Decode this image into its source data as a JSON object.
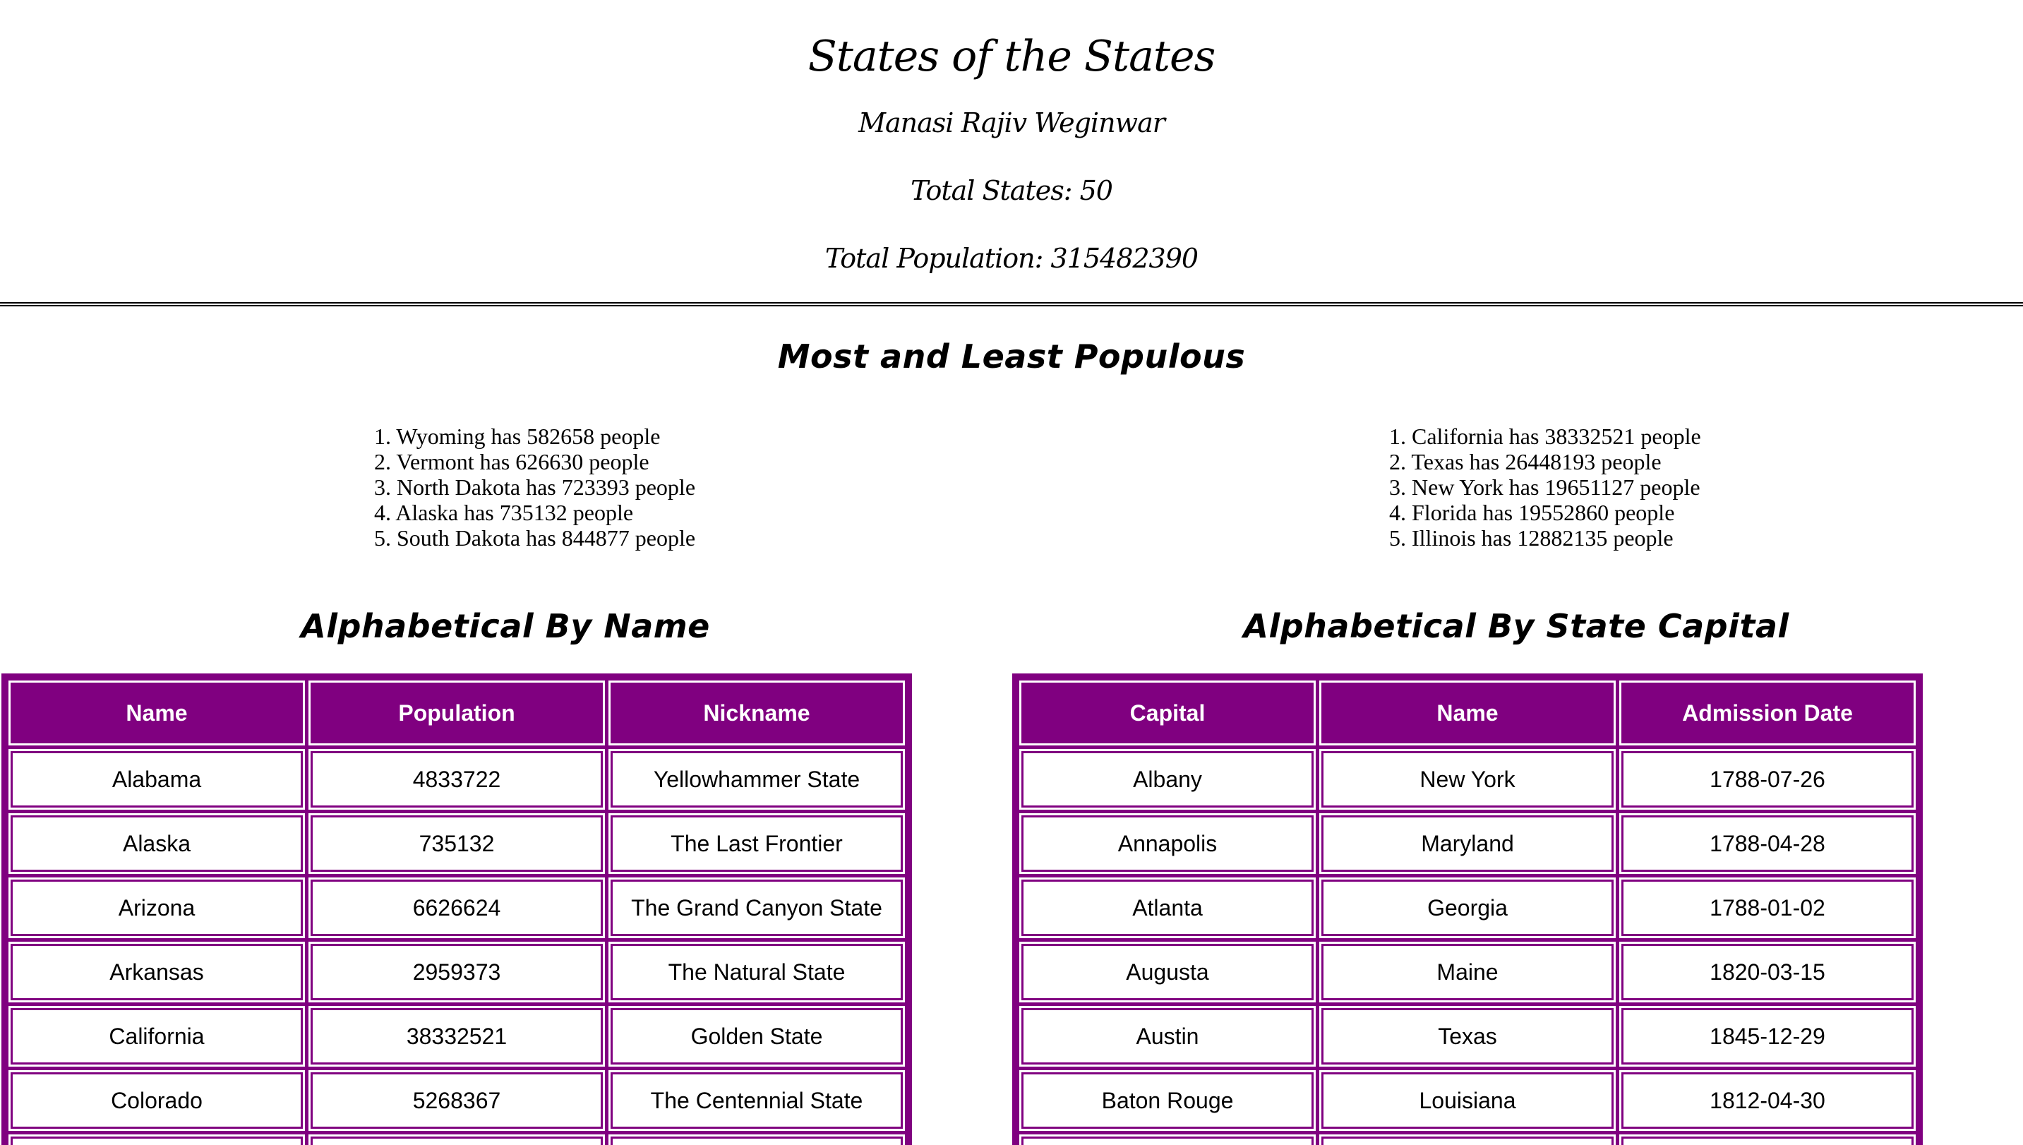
{
  "header": {
    "title": "States of the States",
    "author": "Manasi Rajiv Weginwar",
    "total_states": "Total States: 50",
    "total_population": "Total Population: 315482390"
  },
  "populous": {
    "title": "Most and Least Populous",
    "least": [
      "Wyoming has 582658 people",
      "Vermont has 626630 people",
      "North Dakota has 723393 people",
      "Alaska has 735132 people",
      "South Dakota has 844877 people"
    ],
    "most": [
      "California has 38332521 people",
      "Texas has 26448193 people",
      "New York has 19651127 people",
      "Florida has 19552860 people",
      "Illinois has 12882135 people"
    ]
  },
  "by_name": {
    "title": "Alphabetical By Name",
    "columns": [
      "Name",
      "Population",
      "Nickname"
    ],
    "rows": [
      [
        "Alabama",
        "4833722",
        "Yellowhammer State"
      ],
      [
        "Alaska",
        "735132",
        "The Last Frontier"
      ],
      [
        "Arizona",
        "6626624",
        "The Grand Canyon State"
      ],
      [
        "Arkansas",
        "2959373",
        "The Natural State"
      ],
      [
        "California",
        "38332521",
        "Golden State"
      ],
      [
        "Colorado",
        "5268367",
        "The Centennial State"
      ],
      [
        "",
        "",
        ""
      ]
    ]
  },
  "by_capital": {
    "title": "Alphabetical By State Capital",
    "columns": [
      "Capital",
      "Name",
      "Admission Date"
    ],
    "rows": [
      [
        "Albany",
        "New York",
        "1788-07-26"
      ],
      [
        "Annapolis",
        "Maryland",
        "1788-04-28"
      ],
      [
        "Atlanta",
        "Georgia",
        "1788-01-02"
      ],
      [
        "Augusta",
        "Maine",
        "1820-03-15"
      ],
      [
        "Austin",
        "Texas",
        "1845-12-29"
      ],
      [
        "Baton Rouge",
        "Louisiana",
        "1812-04-30"
      ],
      [
        "",
        "",
        ""
      ]
    ]
  },
  "colors": {
    "accent": "#800080",
    "background": "#ffffff",
    "text": "#000000"
  }
}
